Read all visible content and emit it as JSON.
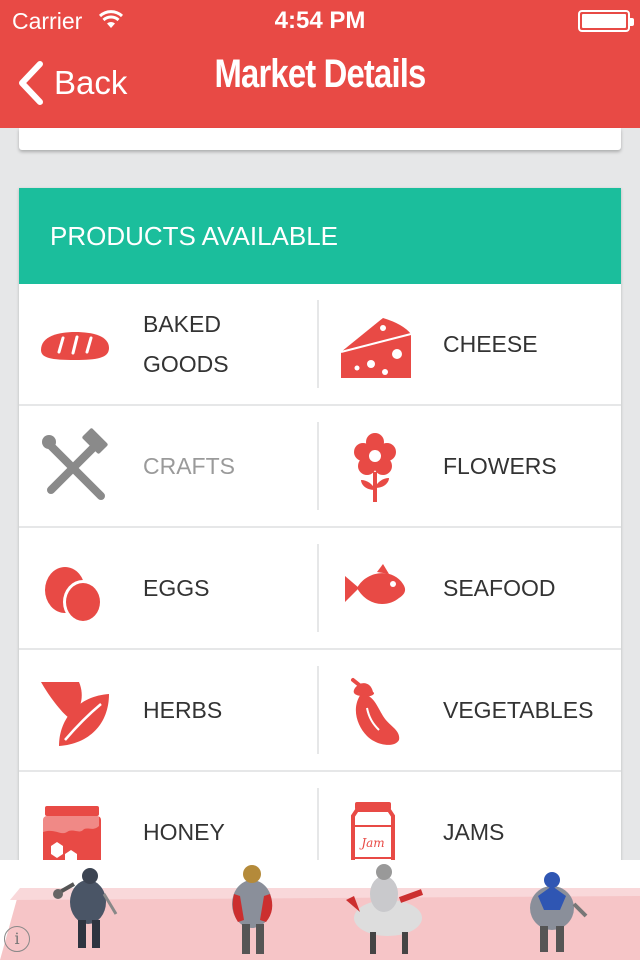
{
  "status_bar": {
    "carrier": "Carrier",
    "time": "4:54 PM"
  },
  "nav": {
    "back_label": "Back",
    "title": "Market Details"
  },
  "products": {
    "heading": "PRODUCTS AVAILABLE",
    "rows": [
      {
        "left": {
          "label": "BAKED GOODS",
          "icon": "bread-icon",
          "available": true
        },
        "right": {
          "label": "CHEESE",
          "icon": "cheese-icon",
          "available": true
        }
      },
      {
        "left": {
          "label": "CRAFTS",
          "icon": "crafts-tools-icon",
          "available": false
        },
        "right": {
          "label": "FLOWERS",
          "icon": "flower-icon",
          "available": true
        }
      },
      {
        "left": {
          "label": "EGGS",
          "icon": "eggs-icon",
          "available": true
        },
        "right": {
          "label": "SEAFOOD",
          "icon": "fish-icon",
          "available": true
        }
      },
      {
        "left": {
          "label": "HERBS",
          "icon": "leaf-icon",
          "available": true
        },
        "right": {
          "label": "VEGETABLES",
          "icon": "eggplant-icon",
          "available": true
        }
      },
      {
        "left": {
          "label": "HONEY",
          "icon": "honey-jar-icon",
          "available": true
        },
        "right": {
          "label": "JAMS",
          "icon": "jam-jar-icon",
          "available": true
        }
      }
    ],
    "jar_label": "Jam"
  },
  "colors": {
    "header": "#e84a45",
    "accent_teal": "#1bbe9c",
    "icon_available": "#e84a45",
    "icon_unavailable": "#8a8a8a",
    "background": "#e6e7e8"
  },
  "ad": {
    "info_glyph": "i"
  }
}
